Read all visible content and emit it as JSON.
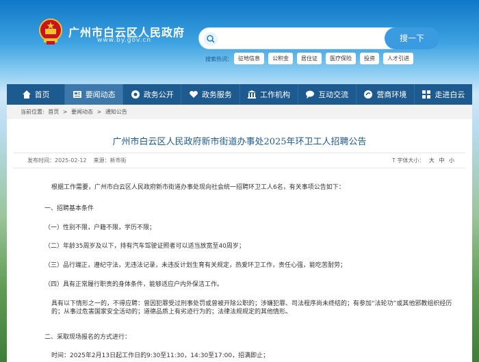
{
  "header": {
    "site_title": "广州市白云区人民政府",
    "site_url": "www.by.gov.cn",
    "search_button": "搜一下",
    "search_placeholder": "",
    "hot_label": "搜索热词：",
    "hot_tags": [
      "征地信息",
      "公积金",
      "居住证",
      "医疗保险",
      "投资",
      "人才引进"
    ]
  },
  "nav": {
    "items": [
      {
        "label": "首页",
        "icon": "home-icon"
      },
      {
        "label": "要闻动态",
        "icon": "news-icon"
      },
      {
        "label": "政务公开",
        "icon": "disclosure-icon"
      },
      {
        "label": "政务服务",
        "icon": "heart-icon"
      },
      {
        "label": "工作机构",
        "icon": "building-icon"
      },
      {
        "label": "互动交流",
        "icon": "chat-icon"
      },
      {
        "label": "营商环境",
        "icon": "business-icon"
      },
      {
        "label": "走进白云",
        "icon": "grid-icon"
      }
    ],
    "active_index": 1
  },
  "breadcrumb": {
    "prefix": "当前位置:",
    "items": [
      "首页",
      "要闻动态",
      "通知公告"
    ],
    "separator": ">"
  },
  "article": {
    "title": "广州市白云区人民政府新市街道办事处2025年环卫工人招聘公告",
    "publish_label": "发布时间：",
    "publish_date": "2025-02-12",
    "source_label": "来源：",
    "source": "新市街",
    "font_size_label": "字体大小：",
    "font_sizes": [
      "大",
      "中",
      "小"
    ],
    "paragraphs": [
      "根据工作需要，广州市白云区人民政府新市街道办事处现向社会统一招聘环卫工人6名，有关事项公告如下：",
      "一、招聘基本条件",
      "（一）性别不限，户籍不限，学历不限；",
      "（二）年龄35周岁及以下，持有汽车驾驶证照者可以适当放宽至40周岁；",
      "（三）品行端正，遵纪守法，无违法记录，未违反计划生育有关规定，热爱环卫工作，责任心强，能吃苦耐劳；",
      "（四）具有正常履行职责的身体条件，能够适应户内外保洁工作。",
      "具有以下情形之一的，不得应聘：曾因犯罪受过刑事处罚或曾被开除公职的；涉嫌犯罪、司法程序尚未终结的；有参加“法轮功”或其他邪教组织经历的；从事过危害国家安全活动的；道德品质上有劣迹行为的；法律法规规定的其他情形。",
      "二、采取现场报名的方式进行：",
      "时间：2025年2月13日起工作日的9:30至11:30，14:30至17:00，招满即止；"
    ]
  },
  "colors": {
    "nav_bg": "#1d5a8f",
    "nav_active": "#3d78ac",
    "title_color": "#1d5a8f",
    "search_button": "#3a9be0"
  }
}
